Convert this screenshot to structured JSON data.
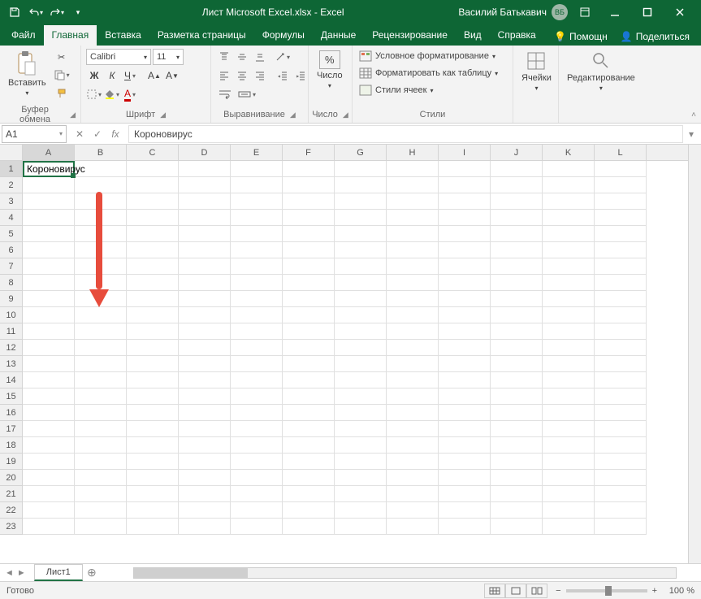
{
  "title": "Лист Microsoft Excel.xlsx  -  Excel",
  "user": {
    "name": "Василий Батькавич",
    "initials": "ВБ"
  },
  "tabs": {
    "file": "Файл",
    "home": "Главная",
    "insert": "Вставка",
    "pagelayout": "Разметка страницы",
    "formulas": "Формулы",
    "data": "Данные",
    "review": "Рецензирование",
    "view": "Вид",
    "help": "Справка",
    "tellme": "Помощн",
    "share": "Поделиться"
  },
  "ribbon": {
    "clipboard": {
      "label": "Буфер обмена",
      "paste": "Вставить"
    },
    "font": {
      "label": "Шрифт",
      "name": "Calibri",
      "size": "11"
    },
    "alignment": {
      "label": "Выравнивание"
    },
    "number": {
      "label": "Число",
      "btn": "Число"
    },
    "styles": {
      "label": "Стили",
      "cond": "Условное форматирование",
      "table": "Форматировать как таблицу",
      "cellstyles": "Стили ячеек"
    },
    "cells": {
      "label": "Ячейки"
    },
    "editing": {
      "label": "Редактирование"
    }
  },
  "formula": {
    "namebox": "A1",
    "value": "Короновирус"
  },
  "columns": [
    "A",
    "B",
    "C",
    "D",
    "E",
    "F",
    "G",
    "H",
    "I",
    "J",
    "K",
    "L"
  ],
  "rows_count": 23,
  "cell_A1": "Короновирус",
  "sheet": {
    "tab1": "Лист1"
  },
  "status": {
    "ready": "Готово",
    "zoom": "100 %"
  }
}
